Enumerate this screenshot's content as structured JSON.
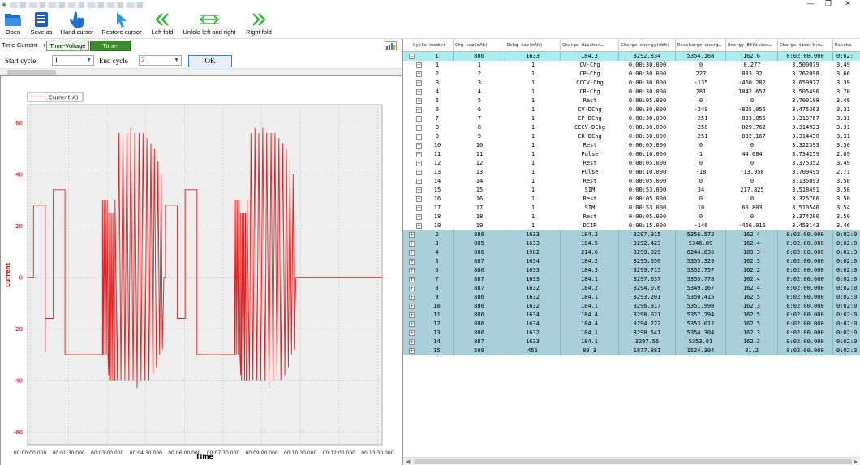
{
  "toolbar": {
    "open": "Open",
    "save_as": "Save as",
    "hand_cursor": "Hand cursor",
    "restore_cursor": "Restore cursor",
    "left_fold": "Left fold",
    "unfold": "Unfold left and right",
    "right_fold": "Right fold"
  },
  "view": {
    "selected": "Time-Current",
    "tab_voltage": "Time-Voltage",
    "tab_current": "Time-Current"
  },
  "cycle": {
    "start_label": "Start cycle:",
    "start_value": "1",
    "end_label": "End cycle",
    "end_value": "2",
    "ok": "OK"
  },
  "chart_data": {
    "type": "line",
    "legend": "Current(A)",
    "xlabel": "Time",
    "ylabel": "Current",
    "ylim": [
      -65,
      67
    ],
    "yticks": [
      "60",
      "40",
      "20",
      "0",
      "-20",
      "-40",
      "-60"
    ],
    "xticks": [
      "00:00:00.000",
      "00:01:30.000",
      "00:03:00.000",
      "00:04:30.000",
      "00:06:00.000",
      "00:07:30.000",
      "00:09:00.000",
      "00:10:30.000",
      "00:12:00.000",
      "00:13:30.000"
    ],
    "line_color": "#e02020",
    "grid": true,
    "series": [
      {
        "name": "Current(A)",
        "points": [
          [
            0,
            0
          ],
          [
            15,
            0
          ],
          [
            15,
            28
          ],
          [
            45,
            28
          ],
          [
            45,
            -29
          ],
          [
            45,
            -16
          ],
          [
            65,
            -16
          ],
          [
            65,
            34
          ],
          [
            95,
            34
          ],
          [
            95,
            -30
          ],
          [
            190,
            -30
          ],
          [
            190,
            30
          ],
          [
            192,
            -30
          ],
          [
            194,
            30
          ],
          [
            196,
            -30
          ],
          [
            198,
            30
          ],
          [
            200,
            -30
          ],
          [
            202,
            30
          ],
          [
            204,
            -30
          ],
          [
            206,
            -38
          ],
          [
            206,
            25
          ],
          [
            208,
            -40
          ],
          [
            210,
            25
          ],
          [
            212,
            -40
          ],
          [
            214,
            25
          ],
          [
            216,
            -40
          ],
          [
            218,
            25
          ],
          [
            220,
            -40
          ],
          [
            222,
            -40
          ],
          [
            222,
            30
          ],
          [
            228,
            -40
          ],
          [
            232,
            56
          ],
          [
            237,
            -40
          ],
          [
            242,
            58
          ],
          [
            247,
            -40
          ],
          [
            252,
            56
          ],
          [
            257,
            -40
          ],
          [
            262,
            58
          ],
          [
            268,
            -40
          ],
          [
            272,
            56
          ],
          [
            278,
            -43
          ],
          [
            283,
            56
          ],
          [
            288,
            -40
          ],
          [
            293,
            56
          ],
          [
            298,
            -40
          ],
          [
            303,
            54
          ],
          [
            308,
            -40
          ],
          [
            313,
            52
          ],
          [
            318,
            -38
          ],
          [
            322,
            50
          ],
          [
            327,
            -35
          ],
          [
            331,
            45
          ],
          [
            335,
            -30
          ],
          [
            339,
            40
          ],
          [
            342,
            -28
          ],
          [
            346,
            0
          ],
          [
            350,
            0
          ],
          [
            350,
            28
          ],
          [
            380,
            28
          ],
          [
            380,
            -16
          ],
          [
            400,
            -16
          ],
          [
            400,
            34
          ],
          [
            430,
            34
          ],
          [
            430,
            -30
          ],
          [
            525,
            -30
          ],
          [
            525,
            30
          ],
          [
            527,
            -30
          ],
          [
            529,
            30
          ],
          [
            531,
            -30
          ],
          [
            533,
            30
          ],
          [
            535,
            -30
          ],
          [
            537,
            30
          ],
          [
            539,
            -30
          ],
          [
            541,
            -38
          ],
          [
            541,
            25
          ],
          [
            543,
            -40
          ],
          [
            545,
            25
          ],
          [
            547,
            -40
          ],
          [
            549,
            25
          ],
          [
            551,
            -40
          ],
          [
            553,
            25
          ],
          [
            555,
            -40
          ],
          [
            557,
            -40
          ],
          [
            557,
            30
          ],
          [
            563,
            -40
          ],
          [
            567,
            56
          ],
          [
            572,
            -40
          ],
          [
            577,
            58
          ],
          [
            582,
            -40
          ],
          [
            587,
            56
          ],
          [
            592,
            -40
          ],
          [
            597,
            58
          ],
          [
            603,
            -40
          ],
          [
            607,
            56
          ],
          [
            613,
            -43
          ],
          [
            618,
            56
          ],
          [
            623,
            -40
          ],
          [
            628,
            56
          ],
          [
            633,
            -40
          ],
          [
            638,
            54
          ],
          [
            643,
            -40
          ],
          [
            648,
            52
          ],
          [
            653,
            -38
          ],
          [
            657,
            50
          ],
          [
            662,
            -35
          ],
          [
            666,
            45
          ],
          [
            670,
            -30
          ],
          [
            674,
            40
          ],
          [
            677,
            -28
          ],
          [
            681,
            0
          ],
          [
            900,
            0
          ]
        ]
      }
    ]
  },
  "grid": {
    "headers": [
      "Cycle number",
      "Chg cap(mAh)",
      "Dchg cap(mAh)",
      "Charge-dischar…",
      "Charge energy(mWh)",
      "Discharge energ…",
      "Energy Efficien…",
      "Charge time(h:m…",
      "Discha"
    ],
    "rows": [
      {
        "kind": "parent",
        "first": true,
        "expanded": true,
        "c": [
          "1",
          "886",
          "1633",
          "184.3",
          "3292.834",
          "5354.168",
          "162.6",
          "0:02:00.000",
          "0:02:"
        ]
      },
      {
        "kind": "child",
        "c": [
          "1",
          "1",
          "1",
          "CV-Chg",
          "0:00:30.000",
          "0",
          "0.277",
          "3.500079",
          "3.49"
        ]
      },
      {
        "kind": "child",
        "c": [
          "2",
          "2",
          "1",
          "CP-Chg",
          "0:00:30.000",
          "227",
          "833.32",
          "3.762098",
          "3.66"
        ]
      },
      {
        "kind": "child",
        "c": [
          "3",
          "3",
          "1",
          "CCCV-Chg",
          "0:00:30.000",
          "-135",
          "-460.282",
          "3.659977",
          "3.39"
        ]
      },
      {
        "kind": "child",
        "c": [
          "4",
          "4",
          "1",
          "CR-Chg",
          "0:00:30.000",
          "281",
          "1042.652",
          "3.505496",
          "3.70"
        ]
      },
      {
        "kind": "child",
        "c": [
          "5",
          "5",
          "1",
          "Rest",
          "0:00:05.000",
          "0",
          "0",
          "3.700108",
          "3.49"
        ]
      },
      {
        "kind": "child",
        "c": [
          "6",
          "6",
          "1",
          "CV-DChg",
          "0:00:30.000",
          "-249",
          "-825.056",
          "3.475363",
          "3.31"
        ]
      },
      {
        "kind": "child",
        "c": [
          "7",
          "7",
          "1",
          "CP-DChg",
          "0:00:30.000",
          "-251",
          "-833.055",
          "3.313767",
          "3.31"
        ]
      },
      {
        "kind": "child",
        "c": [
          "8",
          "8",
          "1",
          "CCCV-DChg",
          "0:00:30.000",
          "-250",
          "-829.762",
          "3.314923",
          "3.31"
        ]
      },
      {
        "kind": "child",
        "c": [
          "9",
          "9",
          "1",
          "CR-DChg",
          "0:00:30.000",
          "-251",
          "-832.167",
          "3.314430",
          "3.31"
        ]
      },
      {
        "kind": "child",
        "c": [
          "10",
          "10",
          "1",
          "Rest",
          "0:00:05.000",
          "0",
          "0",
          "3.322393",
          "3.50"
        ]
      },
      {
        "kind": "child",
        "c": [
          "11",
          "11",
          "1",
          "Pulse",
          "0:00:10.000",
          "1",
          "44.084",
          "3.734259",
          "2.89"
        ]
      },
      {
        "kind": "child",
        "c": [
          "12",
          "12",
          "1",
          "Rest",
          "0:00:05.000",
          "0",
          "0",
          "3.375352",
          "3.49"
        ]
      },
      {
        "kind": "child",
        "c": [
          "13",
          "13",
          "1",
          "Pulse",
          "0:00:10.000",
          "-18",
          "-13.958",
          "3.709495",
          "2.71"
        ]
      },
      {
        "kind": "child",
        "c": [
          "14",
          "14",
          "1",
          "Rest",
          "0:00:05.000",
          "0",
          "0",
          "3.135893",
          "3.50"
        ]
      },
      {
        "kind": "child",
        "c": [
          "15",
          "15",
          "1",
          "SIM",
          "0:00:53.000",
          "34",
          "217.825",
          "3.518491",
          "3.58"
        ]
      },
      {
        "kind": "child",
        "c": [
          "16",
          "16",
          "1",
          "Rest",
          "0:00:05.000",
          "0",
          "0",
          "3.325766",
          "3.50"
        ]
      },
      {
        "kind": "child",
        "c": [
          "17",
          "17",
          "1",
          "SIM",
          "0:00:53.000",
          "10",
          "60.803",
          "3.510546",
          "3.54"
        ]
      },
      {
        "kind": "child",
        "c": [
          "18",
          "18",
          "1",
          "Rest",
          "0:00:05.000",
          "0",
          "0",
          "3.374200",
          "3.50"
        ]
      },
      {
        "kind": "child",
        "c": [
          "19",
          "19",
          "1",
          "DCIR",
          "0:00:15.000",
          "-146",
          "-466.015",
          "3.453143",
          "3.46"
        ]
      },
      {
        "kind": "parent",
        "c": [
          "2",
          "886",
          "1633",
          "184.3",
          "3297.915",
          "5356.572",
          "162.4",
          "0:02:00.000",
          "0:02:0"
        ]
      },
      {
        "kind": "parent",
        "c": [
          "3",
          "885",
          "1633",
          "184.5",
          "3292.423",
          "5346.89",
          "162.4",
          "0:02:00.000",
          "0:02:0"
        ]
      },
      {
        "kind": "parent",
        "c": [
          "4",
          "886",
          "1902",
          "214.6",
          "3299.029",
          "6244.836",
          "189.3",
          "0:02:00.000",
          "0:02:3"
        ]
      },
      {
        "kind": "parent",
        "c": [
          "5",
          "887",
          "1634",
          "184.2",
          "3295.656",
          "5355.329",
          "162.5",
          "0:02:00.000",
          "0:02:0"
        ]
      },
      {
        "kind": "parent",
        "c": [
          "6",
          "886",
          "1633",
          "184.3",
          "3299.715",
          "5352.757",
          "162.2",
          "0:02:00.000",
          "0:02:0"
        ]
      },
      {
        "kind": "parent",
        "c": [
          "7",
          "887",
          "1633",
          "184.1",
          "3297.037",
          "5353.778",
          "162.4",
          "0:02:00.000",
          "0:02:0"
        ]
      },
      {
        "kind": "parent",
        "c": [
          "8",
          "887",
          "1632",
          "184.2",
          "3294.076",
          "5349.167",
          "162.4",
          "0:02:00.000",
          "0:02:0"
        ]
      },
      {
        "kind": "parent",
        "c": [
          "9",
          "886",
          "1632",
          "184.1",
          "3293.201",
          "5350.415",
          "162.5",
          "0:02:00.000",
          "0:02:0"
        ]
      },
      {
        "kind": "parent",
        "c": [
          "10",
          "886",
          "1632",
          "184.1",
          "3296.917",
          "5351.998",
          "162.3",
          "0:02:00.000",
          "0:02:0"
        ]
      },
      {
        "kind": "parent",
        "c": [
          "11",
          "886",
          "1634",
          "184.4",
          "3298.021",
          "5357.794",
          "162.5",
          "0:02:00.000",
          "0:02:0"
        ]
      },
      {
        "kind": "parent",
        "c": [
          "12",
          "886",
          "1634",
          "184.4",
          "3294.222",
          "5353.012",
          "162.5",
          "0:02:00.000",
          "0:02:0"
        ]
      },
      {
        "kind": "parent",
        "c": [
          "13",
          "886",
          "1632",
          "184.1",
          "3298.541",
          "5354.304",
          "162.3",
          "0:02:00.000",
          "0:02:0"
        ]
      },
      {
        "kind": "parent",
        "c": [
          "14",
          "887",
          "1633",
          "184.1",
          "3297.56",
          "5353.01",
          "162.3",
          "0:02:00.000",
          "0:02:0"
        ]
      },
      {
        "kind": "parent",
        "c": [
          "15",
          "509",
          "455",
          "89.3",
          "1877.881",
          "1524.304",
          "81.2",
          "0:02:00.000",
          "0:02:3"
        ]
      }
    ]
  },
  "colors": {
    "accent_green": "#3b8c2a",
    "row_parent": "#a9cfda",
    "row_selected": "#a8f0f0",
    "chart_line": "#e02020",
    "axis_label": "#c00000"
  }
}
